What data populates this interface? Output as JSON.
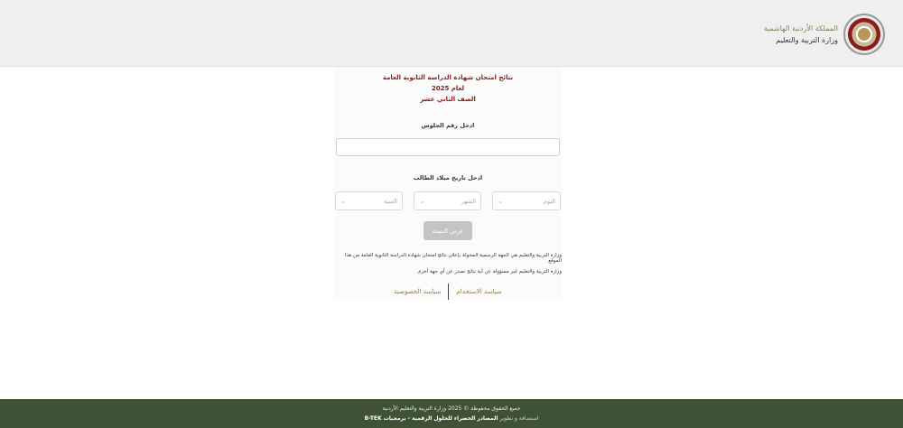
{
  "header": {
    "line1": "المملكة الأردنية الهاشمية",
    "line2": "وزارة التربية والتعليم",
    "emblem_icon": "jordan-coat-of-arms-icon"
  },
  "titles": {
    "line1": "نتائج امتحان شهادة الدراسة الثانوية العامة",
    "line2": "لعام 2025",
    "line3": "الصف الثاني عشر"
  },
  "form": {
    "seat_label": "ادخل رقم الجلوس",
    "seat_value": "",
    "dob_label": "ادخل تاريخ ميلاد الطالب",
    "day_placeholder": "اليوم",
    "month_placeholder": "الشهر",
    "year_placeholder": "السنة",
    "submit_label": "عرض النتيجة"
  },
  "notes": {
    "note1": "وزارة التربية والتعليم هي الجهة الرسمية المخولة بإعلان نتائج امتحان شهادة الدراسة الثانوية العامة من هذا الموقع",
    "note2": "وزارة التربية والتعليم غير مسؤولة عن أية نتائج تصدر عن أي جهة أخرى"
  },
  "links": {
    "terms": "سياسة الاستخدام",
    "privacy": "سياسة الخصوصية"
  },
  "footer": {
    "line1": "جميع الحقوق محفوظة © 2025 وزارة التربية والتعليم الأردنية",
    "line2_prefix": "استضافة و تطوير",
    "line2_strong": "المصادر الخضراء للحلول الرقمية - برمجيات B-TEK"
  },
  "colors": {
    "title": "#8a1c1c",
    "accent": "#8f7e4e",
    "footer_bg": "#3f5236",
    "button_disabled": "#c4c4c4"
  }
}
